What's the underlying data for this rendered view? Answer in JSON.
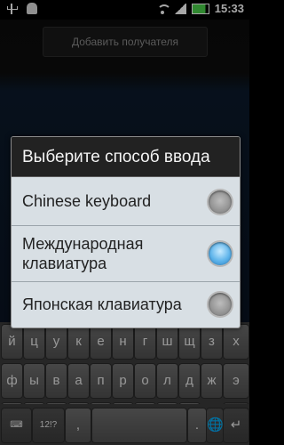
{
  "status_bar": {
    "time": "15:33",
    "icons": [
      "usb-icon",
      "android-icon",
      "wifi-icon",
      "signal-icon",
      "battery-icon"
    ]
  },
  "app": {
    "recipient_placeholder": "Добавить получателя"
  },
  "dialog": {
    "title": "Выберите способ ввода",
    "options": [
      {
        "label": "Chinese keyboard",
        "selected": false
      },
      {
        "label": "Международная клавиатура",
        "selected": true
      },
      {
        "label": "Японская клавиатура",
        "selected": false
      }
    ]
  },
  "keyboard": {
    "row1": [
      "й",
      "ц",
      "у",
      "к",
      "е",
      "н",
      "г",
      "ш",
      "щ",
      "з",
      "х"
    ],
    "row2": [
      "ф",
      "ы",
      "в",
      "а",
      "п",
      "р",
      "о",
      "л",
      "д",
      "ж",
      "э"
    ],
    "row3": [
      "я",
      "ч",
      "с",
      "м",
      "и",
      "т",
      "ь",
      "б",
      "ю",
      "⌫"
    ],
    "row4": [
      "⌨",
      "12!?",
      ",",
      "",
      "",
      ".",
      "🌐",
      "↵"
    ]
  },
  "colors": {
    "dialog_bg": "#d8dfe4",
    "selected_radio": "#5db3ea"
  }
}
